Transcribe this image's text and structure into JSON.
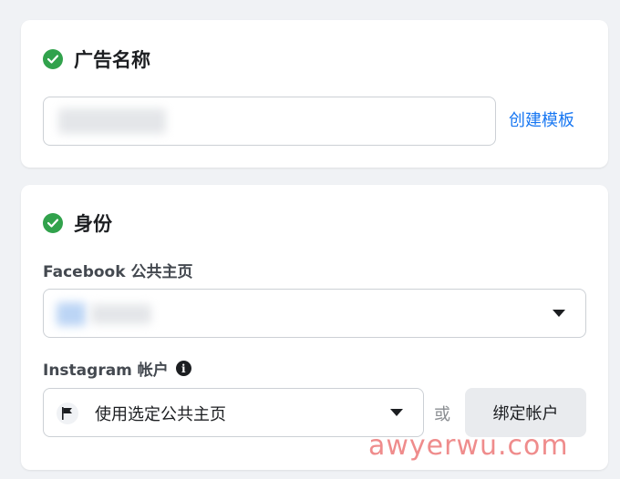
{
  "ad_name_section": {
    "title": "广告名称",
    "input_value": "",
    "create_template_link": "创建模板"
  },
  "identity_section": {
    "title": "身份",
    "facebook_page_label": "Facebook 公共主页",
    "facebook_page_value": "",
    "instagram_label": "Instagram 帐户",
    "instagram_select_value": "使用选定公共主页",
    "or_text": "或",
    "bind_account_button": "绑定帐户"
  },
  "watermark": "awyerwu.com",
  "colors": {
    "check_green": "#31a24c",
    "link_blue": "#1877f2",
    "background": "#f0f2f5"
  },
  "icons": [
    "check-circle-icon",
    "chevron-down-icon",
    "info-icon",
    "flag-icon"
  ]
}
